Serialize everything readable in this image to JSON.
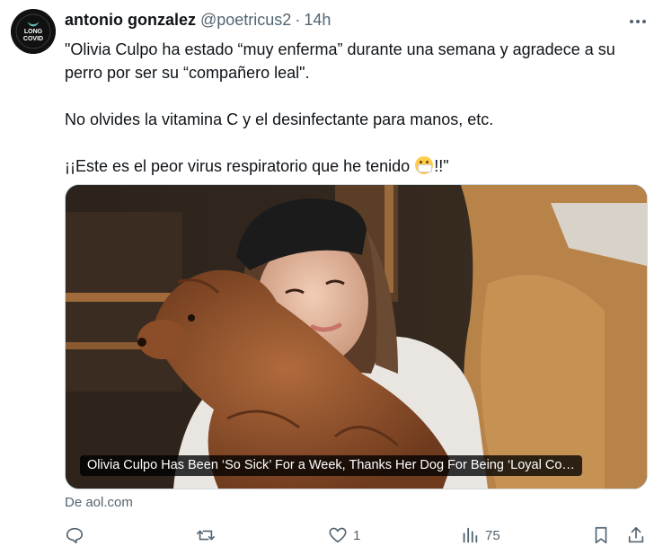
{
  "author": {
    "name": "antonio gonzalez",
    "handle": "@poetricus2",
    "separator": "·",
    "time": "14h",
    "avatar_text_top": "LONG",
    "avatar_text_bottom": "COVID",
    "avatar_ring_top": "LONG COVID",
    "avatar_ring_bottom": "AWARENESS"
  },
  "tweet": {
    "line1": "\"Olivia Culpo ha estado “muy enferma” durante una semana y agradece a su perro por ser su “compañero leal\".",
    "line2": "No olvides la vitamina C y el desinfectante para manos, etc.",
    "line3_before_emoji": "¡¡Este es el peor virus respiratorio que he tenido ",
    "line3_after_emoji": "!!\""
  },
  "card": {
    "title": "Olivia Culpo Has Been ‘So Sick’ For a Week, Thanks Her Dog For Being ‘Loyal Co…",
    "source": "De aol.com"
  },
  "actions": {
    "reply_count": "",
    "retweet_count": "",
    "like_count": "1",
    "views_count": "75"
  },
  "icons": {
    "more": "more-horizontal-icon",
    "reply": "reply-icon",
    "retweet": "retweet-icon",
    "like": "heart-icon",
    "views": "views-icon",
    "bookmark": "bookmark-icon",
    "share": "share-icon"
  },
  "colors": {
    "text": "#0f1419",
    "secondary": "#536471",
    "border": "#cfd9de"
  }
}
